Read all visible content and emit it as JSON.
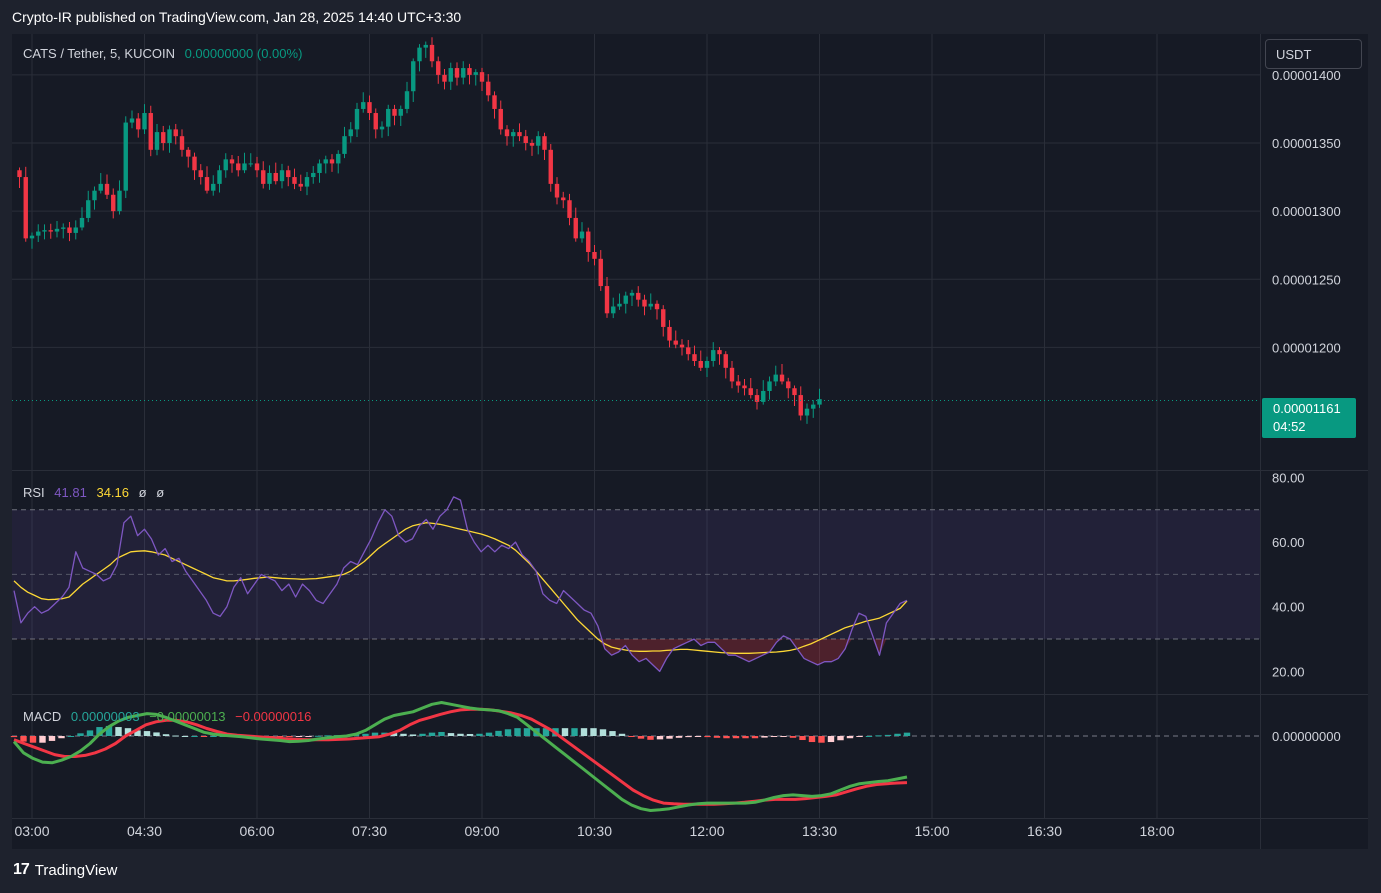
{
  "publish_line": "Crypto-IR published on TradingView.com, Jan 28, 2025 14:40 UTC+3:30",
  "legend": {
    "symbol": "CATS / Tether, 5, KUCOIN",
    "change": "0.00000000 (0.00%)"
  },
  "currency_button": "USDT",
  "last_price": {
    "value": "0.00001161",
    "countdown": "04:52"
  },
  "rsi_legend": {
    "name": "RSI",
    "value": "41.81",
    "ma": "34.16",
    "na1": "ø",
    "na2": "ø"
  },
  "macd_legend": {
    "name": "MACD",
    "hist": "0.00000003",
    "macd": "−0.00000013",
    "signal": "−0.00000016"
  },
  "footer_brand": "TradingView",
  "colors": {
    "up": "#089981",
    "down": "#f23645",
    "rsi": "#7e57c2",
    "rsi_ma": "#fdd835",
    "macd": "#4caf50",
    "signal": "#f23645",
    "hist_up": "#26a69a",
    "hist_up_light": "#b2dfdb",
    "hist_down": "#ff5252",
    "hist_down_light": "#ffcdd2",
    "grid": "#2a2e39",
    "axis_text": "#d1d4dc"
  },
  "chart_data": [
    {
      "type": "candlestick",
      "name": "price",
      "ylim": [
        1.11e-05,
        1.43e-05
      ],
      "yticks": [
        "0.00001400",
        "0.00001350",
        "0.00001300",
        "0.00001250",
        "0.00001200"
      ],
      "ytick_values": [
        1.4e-05,
        1.35e-05,
        1.3e-05,
        1.25e-05,
        1.2e-05
      ],
      "x_ticks": [
        "03:00",
        "04:30",
        "06:00",
        "07:30",
        "09:00",
        "10:30",
        "12:00",
        "13:30",
        "15:00",
        "16:30",
        "18:00"
      ],
      "x_tick_minutes": [
        180,
        270,
        360,
        450,
        540,
        630,
        720,
        810,
        900,
        990,
        1080
      ],
      "first_bar_minute": 170,
      "bar_minutes": 5,
      "closes": [
        13.25,
        12.8,
        12.82,
        12.85,
        12.86,
        12.85,
        12.87,
        12.88,
        12.84,
        12.88,
        12.95,
        13.08,
        13.15,
        13.2,
        13.12,
        13.0,
        13.15,
        13.65,
        13.68,
        13.6,
        13.72,
        13.45,
        13.58,
        13.5,
        13.6,
        13.55,
        13.45,
        13.4,
        13.3,
        13.25,
        13.15,
        13.2,
        13.3,
        13.38,
        13.35,
        13.3,
        13.35,
        13.35,
        13.3,
        13.2,
        13.28,
        13.22,
        13.3,
        13.25,
        13.2,
        13.18,
        13.25,
        13.28,
        13.35,
        13.38,
        13.35,
        13.42,
        13.55,
        13.6,
        13.75,
        13.8,
        13.72,
        13.6,
        13.62,
        13.75,
        13.7,
        13.75,
        13.88,
        14.1,
        14.2,
        14.22,
        14.1,
        14.0,
        13.95,
        14.05,
        13.98,
        14.05,
        14.0,
        14.02,
        13.95,
        13.85,
        13.75,
        13.6,
        13.55,
        13.58,
        13.55,
        13.5,
        13.48,
        13.55,
        13.45,
        13.2,
        13.1,
        13.08,
        12.95,
        12.8,
        12.85,
        12.7,
        12.65,
        12.45,
        12.25,
        12.3,
        12.32,
        12.38,
        12.4,
        12.35,
        12.3,
        12.32,
        12.28,
        12.15,
        12.05,
        12.02,
        12.0,
        11.95,
        11.9,
        11.85,
        11.9,
        11.98,
        11.95,
        11.85,
        11.75,
        11.72,
        11.7,
        11.65,
        11.6,
        11.68,
        11.75,
        11.8,
        11.75,
        11.7,
        11.65,
        11.5,
        11.55,
        11.58,
        11.62
      ],
      "last_price": 1.161e-05
    },
    {
      "type": "line",
      "name": "rsi",
      "ylim": [
        13.0,
        82.0
      ],
      "yticks": [
        "80.00",
        "60.00",
        "40.00",
        "20.00"
      ],
      "ytick_values": [
        80,
        60,
        40,
        20
      ],
      "bands": [
        70,
        50,
        30
      ],
      "rsi": [
        45,
        35,
        38,
        40,
        38,
        39,
        41,
        43,
        46,
        57,
        52,
        51,
        50,
        48,
        49,
        53,
        66,
        68,
        62,
        64,
        61,
        56,
        58,
        54,
        55,
        51,
        48,
        45,
        42,
        38,
        37,
        40,
        46,
        49,
        44,
        47,
        50,
        49,
        48,
        45,
        47,
        43,
        47,
        45,
        42,
        41,
        44,
        47,
        52,
        54,
        53,
        57,
        61,
        66,
        70,
        68,
        62,
        60,
        61,
        65,
        67,
        64,
        68,
        70,
        74,
        73,
        64,
        60,
        57,
        59,
        57,
        59,
        58,
        60,
        56,
        54,
        51,
        44,
        42,
        41,
        45,
        43,
        41,
        39,
        38,
        34,
        27,
        25,
        26,
        28,
        25,
        23,
        24,
        22,
        20,
        24,
        27,
        28,
        29,
        30,
        28,
        29,
        29,
        27,
        25,
        25,
        24,
        23,
        24,
        25,
        26,
        29,
        31,
        30,
        27,
        24,
        23,
        22,
        23,
        23,
        24,
        27,
        33,
        38,
        37,
        31,
        25,
        35,
        38,
        41,
        42
      ],
      "rsi_ma": [
        48,
        46,
        44.5,
        43.5,
        42.5,
        42.2,
        42.3,
        42.5,
        43,
        45,
        47,
        48.5,
        50,
        51.5,
        53,
        55,
        56,
        57,
        57.2,
        57.3,
        57,
        56.5,
        56,
        55,
        54,
        53,
        52,
        51,
        50,
        49,
        48.5,
        48,
        48,
        48.2,
        48.5,
        48.8,
        49,
        49.2,
        49,
        48.8,
        48.7,
        48.6,
        48.5,
        48.6,
        48.7,
        49,
        49.3,
        49.6,
        50,
        51,
        52.5,
        54,
        56,
        58,
        59.5,
        61,
        62.5,
        64,
        65,
        65.5,
        66,
        65.8,
        65.5,
        65,
        64.5,
        64,
        63.5,
        63,
        62.5,
        61.8,
        61,
        60,
        59,
        57.5,
        55.5,
        53.5,
        51,
        48.5,
        46,
        43.5,
        41,
        38.5,
        36,
        34,
        32,
        30,
        28.5,
        27.5,
        27,
        26.6,
        26.3,
        26.2,
        26.2,
        26.3,
        26.3,
        26.5,
        26.6,
        26.8,
        26.8,
        26.6,
        26.4,
        26.2,
        26,
        25.8,
        25.7,
        25.6,
        25.6,
        25.6,
        25.7,
        25.8,
        25.9,
        26,
        26.2,
        26.5,
        27,
        27.8,
        28.5,
        29.5,
        30.5,
        31.5,
        32.5,
        33.5,
        34.16,
        34.8,
        35.5,
        36,
        36.5,
        37.5,
        38.5,
        39.5,
        41.81
      ]
    },
    {
      "type": "line",
      "name": "macd",
      "ylim": [
        -2.2,
        1.1
      ],
      "yticks": [
        "0.00000000"
      ],
      "ytick_values": [
        0
      ],
      "macd": [
        -0.15,
        -0.45,
        -0.6,
        -0.7,
        -0.72,
        -0.65,
        -0.55,
        -0.4,
        -0.2,
        0.05,
        0.25,
        0.4,
        0.5,
        0.55,
        0.6,
        0.58,
        0.5,
        0.4,
        0.3,
        0.2,
        0.1,
        0.05,
        0.02,
        0.0,
        -0.02,
        -0.05,
        -0.08,
        -0.1,
        -0.12,
        -0.15,
        -0.14,
        -0.12,
        -0.08,
        -0.05,
        -0.02,
        0.0,
        0.05,
        0.15,
        0.3,
        0.45,
        0.55,
        0.6,
        0.65,
        0.75,
        0.85,
        0.9,
        0.85,
        0.8,
        0.75,
        0.72,
        0.7,
        0.68,
        0.6,
        0.5,
        0.3,
        0.1,
        -0.1,
        -0.3,
        -0.5,
        -0.7,
        -0.9,
        -1.1,
        -1.3,
        -1.5,
        -1.7,
        -1.85,
        -1.95,
        -2.0,
        -1.98,
        -1.95,
        -1.9,
        -1.85,
        -1.82,
        -1.8,
        -1.8,
        -1.8,
        -1.8,
        -1.8,
        -1.78,
        -1.72,
        -1.65,
        -1.6,
        -1.58,
        -1.6,
        -1.62,
        -1.6,
        -1.55,
        -1.45,
        -1.35,
        -1.28,
        -1.25,
        -1.22,
        -1.2,
        -1.15,
        -1.1
      ],
      "signal": [
        -0.1,
        -0.2,
        -0.3,
        -0.4,
        -0.5,
        -0.55,
        -0.55,
        -0.52,
        -0.45,
        -0.35,
        -0.2,
        0.0,
        0.15,
        0.3,
        0.38,
        0.42,
        0.42,
        0.38,
        0.3,
        0.2,
        0.12,
        0.05,
        0.02,
        0.0,
        -0.02,
        -0.04,
        -0.06,
        -0.08,
        -0.09,
        -0.1,
        -0.1,
        -0.1,
        -0.09,
        -0.08,
        -0.06,
        -0.04,
        -0.02,
        0.05,
        0.15,
        0.3,
        0.42,
        0.5,
        0.58,
        0.65,
        0.7,
        0.72,
        0.72,
        0.7,
        0.66,
        0.62,
        0.55,
        0.45,
        0.3,
        0.15,
        -0.05,
        -0.25,
        -0.45,
        -0.65,
        -0.85,
        -1.05,
        -1.25,
        -1.45,
        -1.6,
        -1.72,
        -1.8,
        -1.82,
        -1.83,
        -1.83,
        -1.83,
        -1.83,
        -1.82,
        -1.8,
        -1.78,
        -1.75,
        -1.72,
        -1.7,
        -1.7,
        -1.7,
        -1.68,
        -1.65,
        -1.62,
        -1.58,
        -1.5,
        -1.42,
        -1.35,
        -1.3,
        -1.28,
        -1.26,
        -1.25
      ]
    }
  ]
}
